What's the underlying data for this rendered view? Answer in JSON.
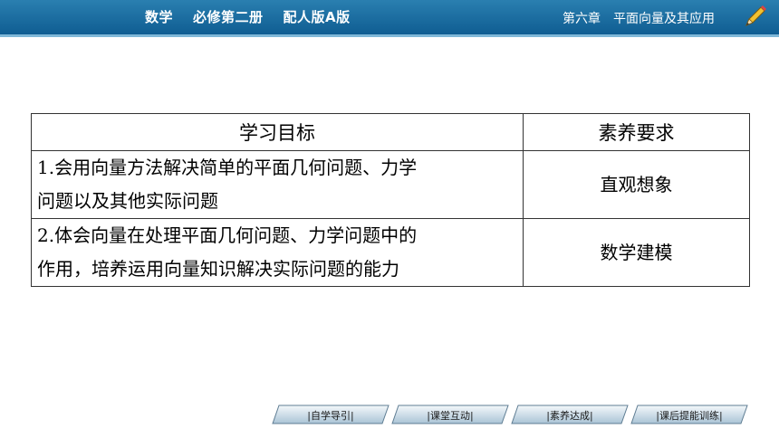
{
  "header": {
    "subject": "数学",
    "book": "必修第二册",
    "edition": "配人版A版",
    "chapter": "第六章",
    "chapter_title": "平面向量及其应用",
    "accent_color": "#0f5d92",
    "icon": "pencil-icon"
  },
  "table": {
    "col_target": "学习目标",
    "col_requirement": "素养要求",
    "rows": [
      {
        "line1": "1.会用向量方法解决简单的平面几何问题、力学",
        "line2": "问题以及其他实际问题",
        "requirement": "直观想象"
      },
      {
        "line1": "2.体会向量在处理平面几何问题、力学问题中的",
        "line2": "作用，培养运用向量知识解决实际问题的能力",
        "requirement": "数学建模"
      }
    ]
  },
  "nav": {
    "buttons": [
      "|自学导引|",
      "|课堂互动|",
      "|素养达成|",
      "|课后提能训练|"
    ]
  }
}
